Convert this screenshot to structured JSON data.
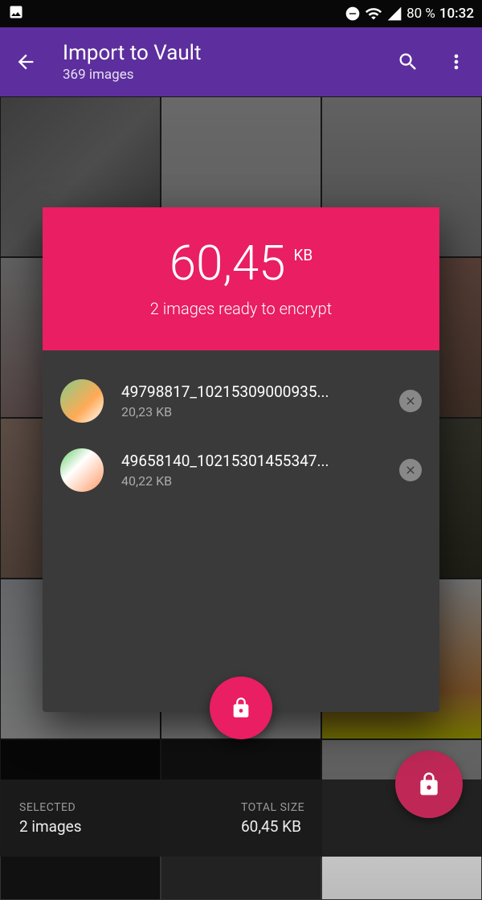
{
  "status_bar": {
    "battery_pct": "80 %",
    "time": "10:32"
  },
  "app_bar": {
    "title": "Import to Vault",
    "subtitle": "369 images"
  },
  "dialog": {
    "total_size_value": "60,45",
    "total_size_unit": "KB",
    "ready_text": "2 images ready to encrypt",
    "items": [
      {
        "name": "49798817_10215309000935...",
        "size": "20,23 KB"
      },
      {
        "name": "49658140_10215301455347...",
        "size": "40,22 KB"
      }
    ]
  },
  "bottom_bar": {
    "selected_label": "SELECTED",
    "selected_value": "2 images",
    "total_label": "TOTAL SIZE",
    "total_value": "60,45 KB"
  },
  "colors": {
    "accent": "#e91e63",
    "app_bar": "#5d2e9e"
  }
}
